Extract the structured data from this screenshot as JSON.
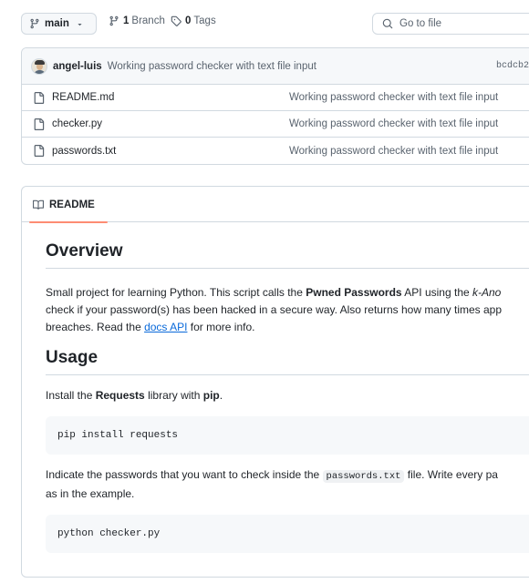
{
  "topbar": {
    "branch_name": "main",
    "branches_count": "1",
    "branches_label": "Branch",
    "tags_count": "0",
    "tags_label": "Tags",
    "goto_placeholder": "Go to file"
  },
  "latest_commit": {
    "author": "angel-luis",
    "message": "Working password checker with text file input",
    "sha": "bcdcb2"
  },
  "files": [
    {
      "name": "README.md",
      "message": "Working password checker with text file input",
      "icon": "file-icon"
    },
    {
      "name": "checker.py",
      "message": "Working password checker with text file input",
      "icon": "file-icon"
    },
    {
      "name": "passwords.txt",
      "message": "Working password checker with text file input",
      "icon": "file-icon"
    }
  ],
  "readme": {
    "tab_label": "README",
    "overview_heading": "Overview",
    "overview_p1_a": "Small project for learning Python. This script calls the ",
    "overview_p1_b": "Pwned Passwords",
    "overview_p1_c": " API using the ",
    "overview_p1_d": "k-Ano",
    "overview_p2": "check if your password(s) has been hacked in a secure way. Also returns how many times app",
    "overview_p3_a": "breaches. Read the ",
    "overview_p3_link": "docs API",
    "overview_p3_b": " for more info.",
    "usage_heading": "Usage",
    "usage_p1_a": "Install the ",
    "usage_p1_b": "Requests",
    "usage_p1_c": " library with ",
    "usage_p1_d": "pip",
    "usage_p1_e": ".",
    "code1": "pip install requests",
    "usage_p2_a": "Indicate the passwords that you want to check inside the ",
    "usage_p2_code": "passwords.txt",
    "usage_p2_b": " file. Write every pa",
    "usage_p3": "as in the example.",
    "code2": "python checker.py"
  }
}
